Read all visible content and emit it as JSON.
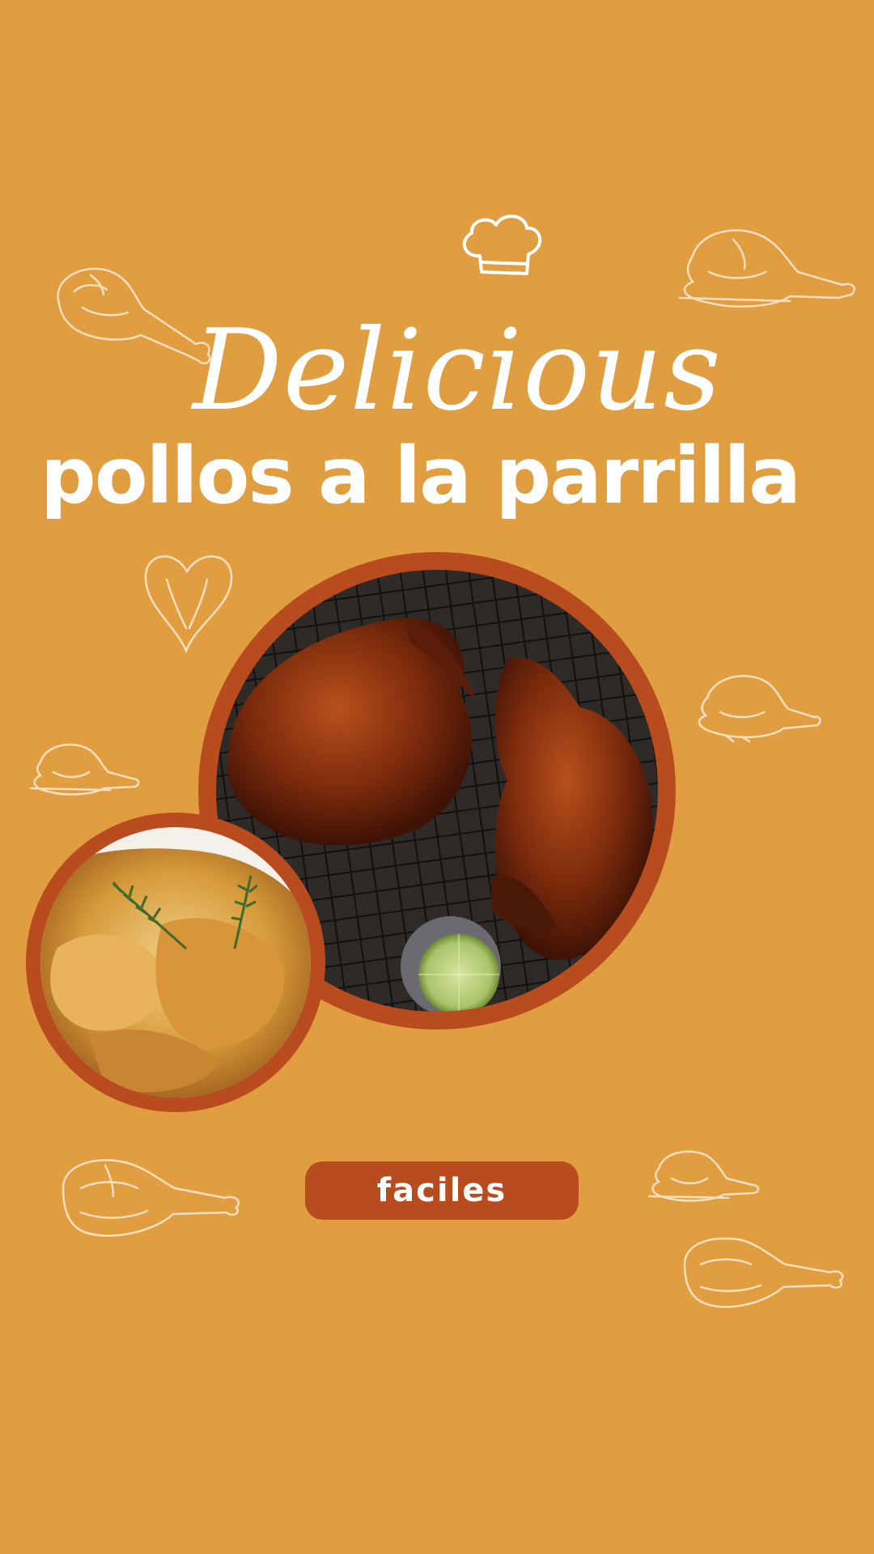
{
  "poster": {
    "script_title": "Delicious",
    "main_title": "pollos a la parrilla",
    "badge_label": "faciles"
  },
  "colors": {
    "background": "#E19E41",
    "accent": "#B84C1E",
    "text": "#FFFFFF",
    "doodle_stroke": "#F6DFC0"
  },
  "icons": [
    "chef-hat-icon",
    "chicken-leg-icon",
    "roast-chicken-icon",
    "chicken-breast-icon"
  ],
  "photos": [
    {
      "subject": "grilled-chickens-on-rack",
      "style": "circle"
    },
    {
      "subject": "roasted-chicken-wings-with-rosemary",
      "style": "circle"
    }
  ]
}
